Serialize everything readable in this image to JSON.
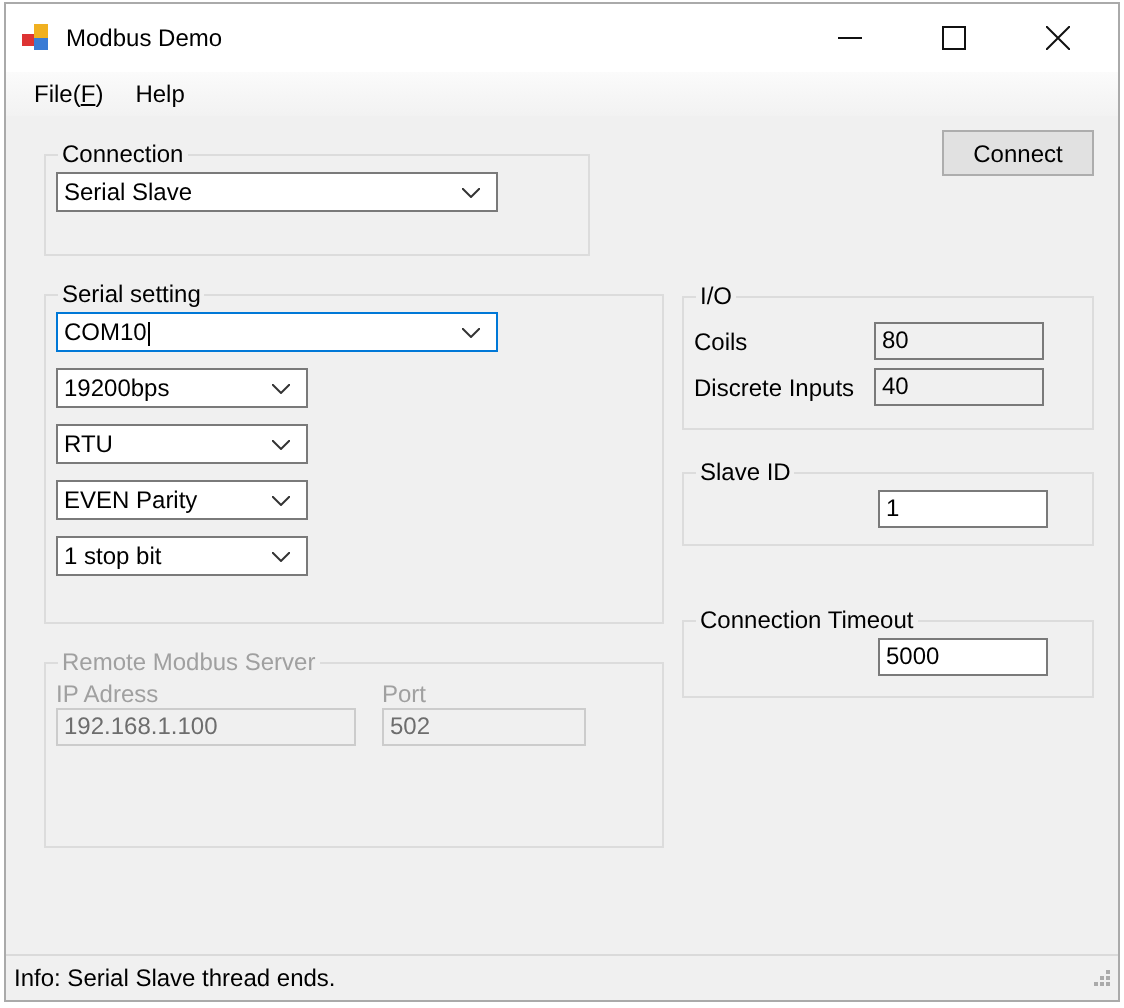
{
  "window": {
    "title": "Modbus Demo"
  },
  "menu": [
    {
      "label": "File(",
      "access": "F",
      "suffix": ")"
    },
    {
      "label": "Help"
    }
  ],
  "connection": {
    "title": "Connection",
    "value": "Serial Slave"
  },
  "connect_button": "Connect",
  "serial": {
    "title": "Serial setting",
    "port": {
      "value": "COM10",
      "focused": true
    },
    "options": [
      {
        "value": "19200bps"
      },
      {
        "value": "RTU"
      },
      {
        "value": "EVEN Parity"
      },
      {
        "value": "1 stop bit"
      }
    ]
  },
  "remote": {
    "title": "Remote Modbus Server",
    "disabled": true,
    "ip_label": "IP Adress",
    "ip": "192.168.1.100",
    "port_label": "Port",
    "port": "502"
  },
  "io": {
    "title": "I/O",
    "fields": [
      {
        "label": "Coils",
        "value": "80",
        "readonly": true
      },
      {
        "label": "Discrete Inputs",
        "value": "40",
        "readonly": true
      }
    ]
  },
  "slave_id": {
    "title": "Slave ID",
    "value": "1"
  },
  "timeout": {
    "title": "Connection Timeout",
    "value": "5000"
  },
  "status_bar": "Info: Serial Slave thread ends."
}
